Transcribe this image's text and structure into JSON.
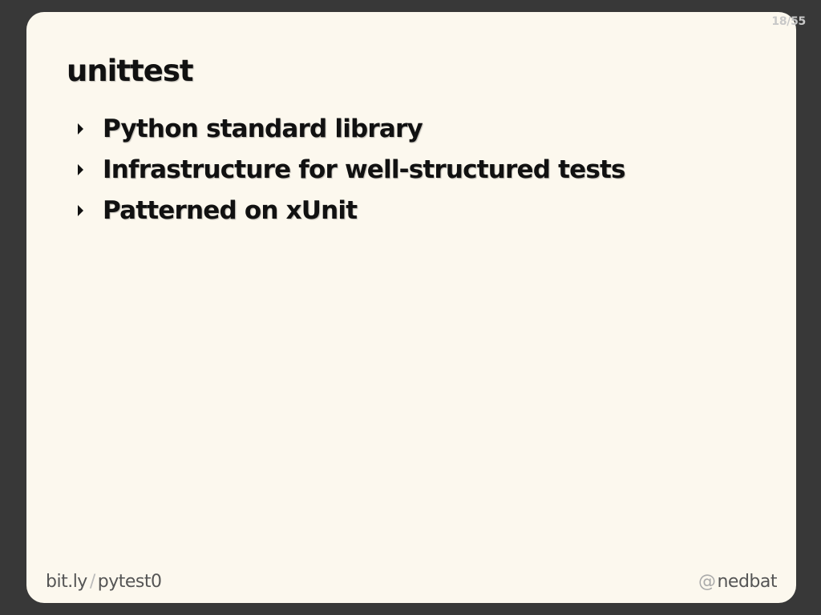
{
  "slide": {
    "counter": "18/55",
    "title": "unittest",
    "bullets": [
      {
        "text": "Python standard library",
        "icon": "triangle-right-icon"
      },
      {
        "text": "Infrastructure for well-structured tests",
        "icon": "triangle-right-icon"
      },
      {
        "text": "Patterned on xUnit",
        "icon": "triangle-right-icon"
      }
    ]
  },
  "footer": {
    "link_domain": "bit.ly",
    "link_separator": "/",
    "link_path": "pytest0",
    "handle_prefix": "@",
    "handle": "nedbat"
  },
  "colors": {
    "background": "#383838",
    "slide": "#fcf8ee",
    "text": "#111111",
    "footer_text": "#555555"
  }
}
